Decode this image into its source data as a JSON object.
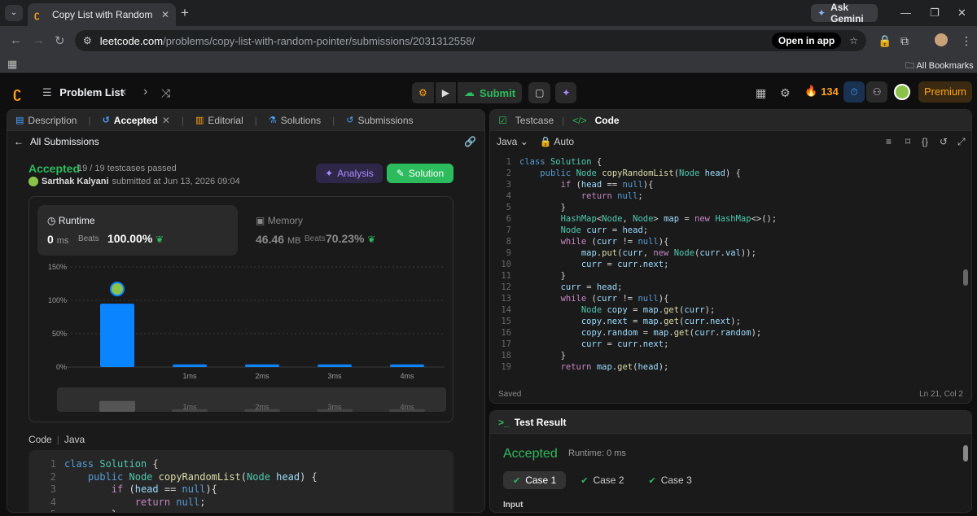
{
  "browser": {
    "tab_title": "Copy List with Random Pointer",
    "ask_gemini": "Ask Gemini",
    "url_host": "leetcode.com",
    "url_path": "/problems/copy-list-with-random-pointer/submissions/2031312558/",
    "open_in_app": "Open in app",
    "all_bookmarks": "All Bookmarks"
  },
  "nav": {
    "problem_list": "Problem List",
    "submit": "Submit",
    "streak": "134",
    "premium": "Premium"
  },
  "left_tabs": [
    {
      "label": "Description"
    },
    {
      "label": "Accepted"
    },
    {
      "label": "Editorial"
    },
    {
      "label": "Solutions"
    },
    {
      "label": "Submissions"
    }
  ],
  "submission": {
    "all_submissions": "All Submissions",
    "status": "Accepted",
    "testcases": "19 / 19 testcases passed",
    "user": "Sarthak Kalyani",
    "submitted_at": "submitted at Jun 13, 2026 09:04",
    "analysis": "Analysis",
    "solution": "Solution",
    "runtime_label": "Runtime",
    "runtime_value": "0",
    "runtime_unit": "ms",
    "beats_label": "Beats",
    "runtime_beats": "100.00%",
    "memory_label": "Memory",
    "memory_value": "46.46",
    "memory_unit": "MB",
    "memory_beats": "70.23%",
    "code_label": "Code",
    "code_lang": "Java"
  },
  "chart_data": {
    "type": "bar",
    "categories": [
      "",
      "1ms",
      "2ms",
      "3ms",
      "4ms"
    ],
    "values": [
      95,
      4,
      4,
      4,
      4
    ],
    "yticks": [
      "150%",
      "100%",
      "50%",
      "0%"
    ],
    "ylim": [
      0,
      150
    ],
    "highlight_index": 0,
    "bar_color": "#0a84ff",
    "navigator_labels": [
      "1ms",
      "2ms",
      "3ms",
      "4ms"
    ]
  },
  "right_tabs": {
    "testcase": "Testcase",
    "code": "Code",
    "lang": "Java",
    "auto": "Auto",
    "saved": "Saved",
    "cursor": "Ln 21, Col 2"
  },
  "code_lines": [
    "class Solution {",
    "    public Node copyRandomList(Node head) {",
    "        if (head == null){",
    "            return null;",
    "        }",
    "        HashMap<Node, Node> map = new HashMap<>();",
    "        Node curr = head;",
    "        while (curr != null){",
    "            map.put(curr, new Node(curr.val));",
    "            curr = curr.next;",
    "        }",
    "        curr = head;",
    "        while (curr != null){",
    "            Node copy = map.get(curr);",
    "            copy.next = map.get(curr.next);",
    "            copy.random = map.get(curr.random);",
    "            curr = curr.next;",
    "        }",
    "        return map.get(head);"
  ],
  "left_code_lines": [
    "class Solution {",
    "    public Node copyRandomList(Node head) {",
    "        if (head == null){",
    "            return null;",
    "        }"
  ],
  "test_result": {
    "title": "Test Result",
    "status": "Accepted",
    "runtime": "Runtime: 0 ms",
    "cases": [
      "Case 1",
      "Case 2",
      "Case 3"
    ],
    "input_label": "Input"
  }
}
